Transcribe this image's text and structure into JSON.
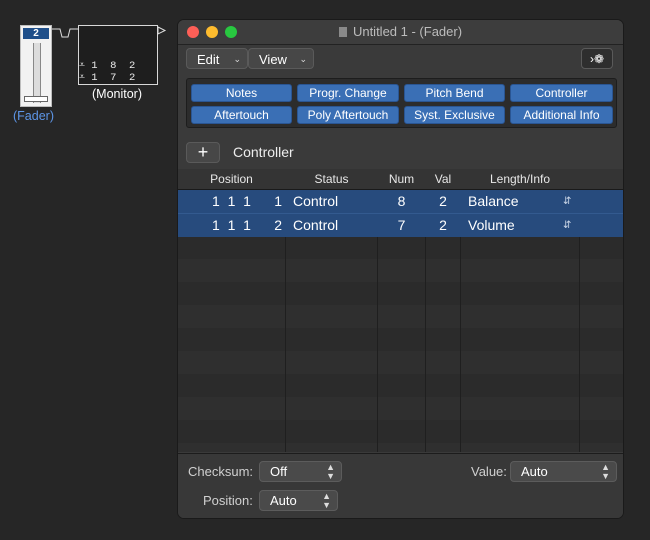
{
  "environment": {
    "fader": {
      "value": "2",
      "label": "(Fader)"
    },
    "monitor": {
      "lines": [
        "⩡ 1  8  2",
        "⩡ 1  7  2"
      ],
      "label": "(Monitor)"
    }
  },
  "window": {
    "title": "Untitled 1 - (Fader)",
    "toolbar": {
      "edit_label": "Edit",
      "view_label": "View",
      "mode_label": "›❁"
    },
    "filters": [
      {
        "label": "Notes"
      },
      {
        "label": "Progr. Change"
      },
      {
        "label": "Pitch Bend"
      },
      {
        "label": "Controller"
      },
      {
        "label": "Aftertouch"
      },
      {
        "label": "Poly Aftertouch"
      },
      {
        "label": "Syst. Exclusive"
      },
      {
        "label": "Additional Info"
      }
    ],
    "create": {
      "plus": "+",
      "label": "Controller"
    },
    "columns": {
      "position": "Position",
      "status": "Status",
      "num": "Num",
      "val": "Val",
      "length": "Length/Info"
    },
    "events": [
      {
        "position": "1  1  1      1",
        "status": "Control",
        "num": "8",
        "val": "2",
        "info": "Balance"
      },
      {
        "position": "1  1  1      2",
        "status": "Control",
        "num": "7",
        "val": "2",
        "info": "Volume"
      }
    ],
    "bottom": {
      "checksum_label": "Checksum:",
      "checksum_value": "Off",
      "value_label": "Value:",
      "value_value": "Auto",
      "position_label": "Position:",
      "position_value": "Auto"
    },
    "colors": {
      "selection": "#274b7d",
      "filter_button": "#3a6fb5",
      "fader_label": "#5d96e8"
    }
  }
}
